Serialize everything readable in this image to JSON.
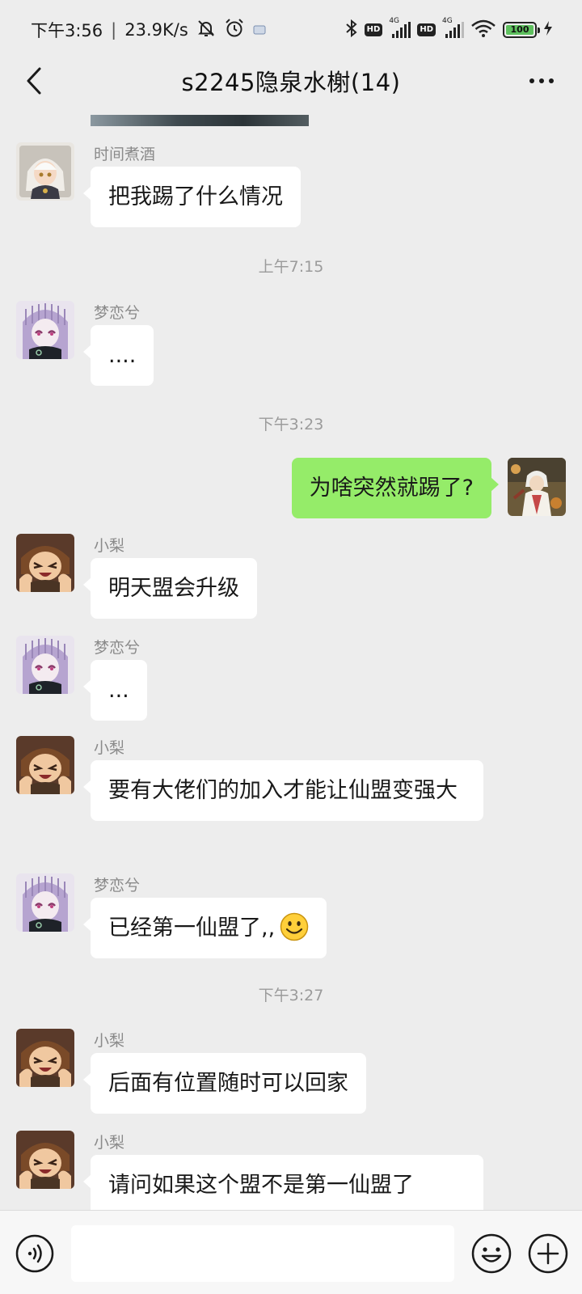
{
  "status_bar": {
    "time": "下午3:56",
    "speed": "23.9K/s",
    "hd1": "HD",
    "hd2": "HD",
    "net1": "4G",
    "net2": "4G",
    "battery": "100"
  },
  "header": {
    "title": "s2245隐泉水榭(14)"
  },
  "messages": [
    {
      "sender": "时间煮酒",
      "text": "把我踢了什么情况"
    },
    {
      "sender": "梦恋兮",
      "text": "...."
    },
    {
      "text": "为啥突然就踢了?"
    },
    {
      "sender": "小梨",
      "text": "明天盟会升级"
    },
    {
      "sender": "梦恋兮",
      "text": "..."
    },
    {
      "sender": "小梨",
      "text": "要有大佬们的加入才能让仙盟变强大"
    },
    {
      "sender": "梦恋兮",
      "text": "已经第一仙盟了,,"
    },
    {
      "sender": "小梨",
      "text": "后面有位置随时可以回家"
    },
    {
      "sender": "小梨",
      "text": "请问如果这个盟不是第一仙盟了"
    }
  ],
  "timestamps": [
    "上午7:15",
    "下午3:23",
    "下午3:27"
  ],
  "colors": {
    "background": "#ededed",
    "self_bubble": "#95ec69",
    "other_bubble": "#ffffff"
  },
  "icons": {
    "back": "back-arrow-icon",
    "more": "more-dots-icon",
    "voice": "voice-icon",
    "emoji": "emoji-icon",
    "plus": "plus-icon"
  }
}
